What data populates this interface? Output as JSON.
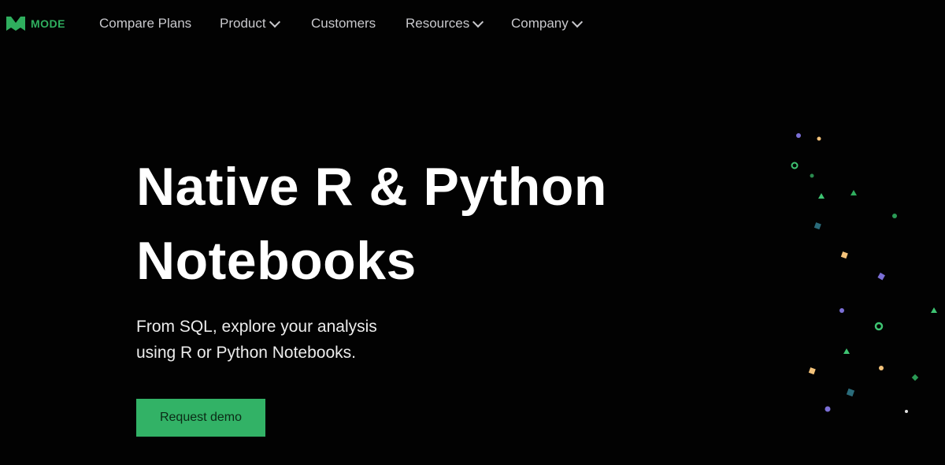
{
  "brand": {
    "name": "MODE",
    "color": "#2fae5e"
  },
  "nav": {
    "items": [
      {
        "label": "Compare Plans",
        "dropdown": false
      },
      {
        "label": "Product",
        "dropdown": true
      },
      {
        "label": "Customers",
        "dropdown": false
      },
      {
        "label": "Resources",
        "dropdown": true
      },
      {
        "label": "Company",
        "dropdown": true
      }
    ]
  },
  "hero": {
    "title_line1": "Native R & Python",
    "title_line2": "Notebooks",
    "subtitle_line1": "From SQL, explore your analysis",
    "subtitle_line2": "using R or Python Notebooks.",
    "cta_label": "Request demo",
    "cta_color": "#32b266"
  },
  "decor": {
    "colors": {
      "purple": "#7b6fd6",
      "orange": "#f3c27a",
      "green": "#3ec472",
      "teal": "#2a6b7a",
      "white": "#e0e0e0"
    }
  }
}
